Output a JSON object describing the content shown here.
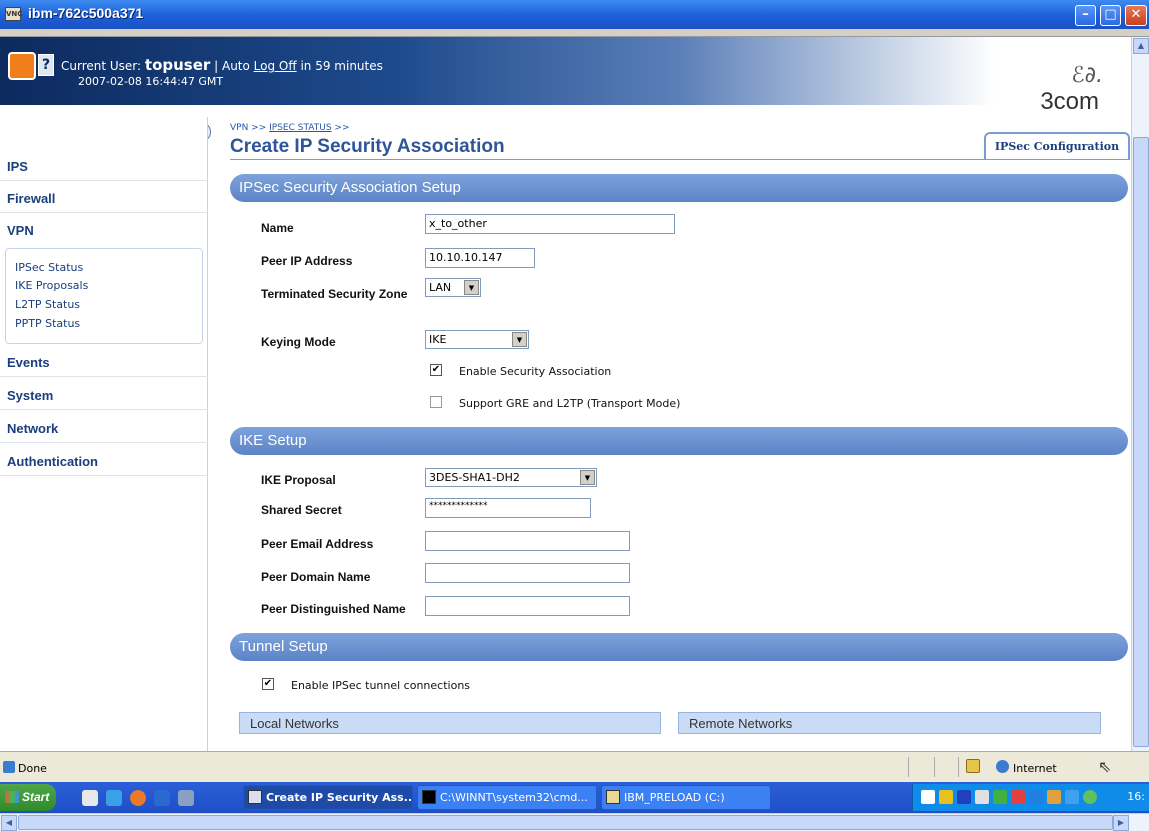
{
  "window": {
    "title": "ibm-762c500a371"
  },
  "header": {
    "user_label": "Current User:",
    "user_name": "topuser",
    "auto_prefix": "| Auto",
    "logoff_link": "Log Off",
    "logoff_suffix": "in 59 minutes",
    "datetime": "2007-02-08 16:44:47 GMT",
    "logo": "3com"
  },
  "sidebar": {
    "items": [
      {
        "label": "IPS"
      },
      {
        "label": "Firewall"
      },
      {
        "label": "VPN"
      },
      {
        "label": "Events"
      },
      {
        "label": "System"
      },
      {
        "label": "Network"
      },
      {
        "label": "Authentication"
      }
    ],
    "vpn_sub": [
      {
        "label": "IPSec Status"
      },
      {
        "label": "IKE Proposals"
      },
      {
        "label": "L2TP Status"
      },
      {
        "label": "PPTP Status"
      }
    ]
  },
  "breadcrumb": {
    "root": "VPN >>",
    "link": "IPSEC STATUS",
    "tail": ">>"
  },
  "page_title": "Create IP Security Association",
  "tab": {
    "label": "IPSec Configuration"
  },
  "sa_setup": {
    "header": "IPSec Security Association Setup",
    "name_label": "Name",
    "name_value": "x_to_other",
    "peer_ip_label": "Peer IP Address",
    "peer_ip_value": "10.10.10.147",
    "zone_label": "Terminated Security Zone",
    "zone_value": "LAN",
    "keying_label": "Keying Mode",
    "keying_value": "IKE",
    "enable_sa_label": "Enable Security Association",
    "enable_sa_checked": true,
    "gre_label": "Support GRE and L2TP (Transport Mode)",
    "gre_checked": false
  },
  "ike_setup": {
    "header": "IKE Setup",
    "proposal_label": "IKE Proposal",
    "proposal_value": "3DES-SHA1-DH2",
    "secret_label": "Shared Secret",
    "secret_value": "*************",
    "email_label": "Peer Email Address",
    "email_value": "",
    "domain_label": "Peer Domain Name",
    "domain_value": "",
    "dn_label": "Peer Distinguished Name",
    "dn_value": ""
  },
  "tunnel_setup": {
    "header": "Tunnel Setup",
    "enable_label": "Enable IPSec tunnel connections",
    "enable_checked": true,
    "local_header": "Local Networks",
    "remote_header": "Remote Networks"
  },
  "statusbar": {
    "status": "Done",
    "zone": "Internet"
  },
  "taskbar": {
    "start": "Start",
    "tasks": [
      {
        "label": "Create IP Security Ass..."
      },
      {
        "label": "C:\\WINNT\\system32\\cmd..."
      },
      {
        "label": "IBM_PRELOAD (C:)"
      }
    ],
    "clock": "16:"
  },
  "colors": {
    "navy": "#0c2a5e",
    "section": "#5b83c6",
    "accent": "#2f5599",
    "taskbar": "#1e4fc7"
  }
}
